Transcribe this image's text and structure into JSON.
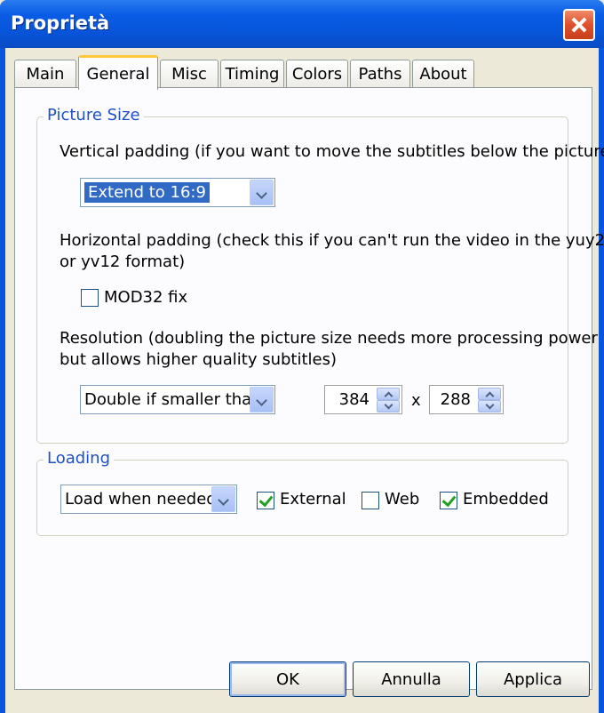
{
  "window": {
    "title": "Proprietà"
  },
  "tabs": [
    {
      "label": "Main"
    },
    {
      "label": "General",
      "active": true
    },
    {
      "label": "Misc"
    },
    {
      "label": "Timing"
    },
    {
      "label": "Colors"
    },
    {
      "label": "Paths"
    },
    {
      "label": "About"
    }
  ],
  "picture_size": {
    "title": "Picture Size",
    "vertical_label": "Vertical padding (if you want to move the subtitles below the picture)",
    "vertical_value": "Extend to 16:9",
    "horizontal_label_1": "Horizontal padding (check this if you can't run the video in the yuy2",
    "horizontal_label_2": "or yv12 format)",
    "mod32_label": "MOD32 fix",
    "mod32_checked": false,
    "resolution_label_1": "Resolution (doubling the picture size needs more processing power",
    "resolution_label_2": "but allows higher quality subtitles)",
    "resolution_mode": "Double if smaller than",
    "width": "384",
    "separator": "x",
    "height": "288"
  },
  "loading": {
    "title": "Loading",
    "mode": "Load when needed",
    "external_label": "External",
    "external_checked": true,
    "web_label": "Web",
    "web_checked": false,
    "embedded_label": "Embedded",
    "embedded_checked": true
  },
  "buttons": {
    "ok": "OK",
    "cancel": "Annulla",
    "apply": "Applica"
  },
  "icons": [
    "close-icon",
    "chevron-down-icon",
    "spin-up-icon",
    "spin-down-icon",
    "checkmark-icon"
  ],
  "colors": {
    "titlebar": "#0a55e0",
    "group_title": "#2050c8",
    "selection": "#316ac5",
    "check": "#21a121"
  }
}
